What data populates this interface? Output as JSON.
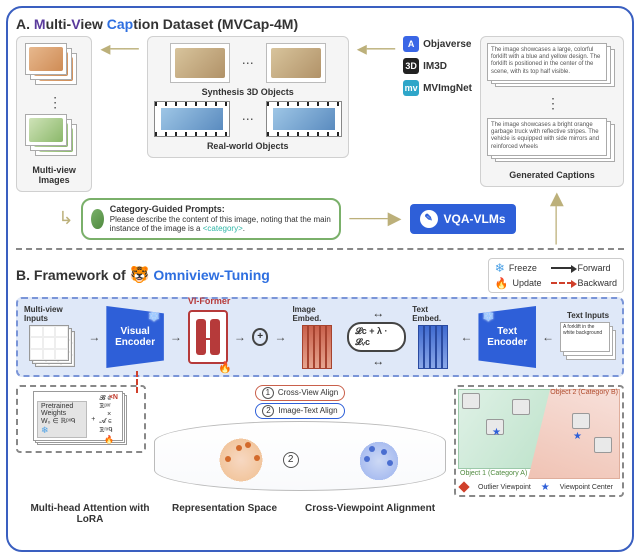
{
  "panelA": {
    "heading_prefix": "A. ",
    "heading_M": "M",
    "heading_ulti": "ulti-",
    "heading_V": "V",
    "heading_iew": "iew ",
    "heading_Cap": "Cap",
    "heading_tion": "tion Dataset (MVCap-4M)",
    "left_box_label": "Multi-view Images",
    "objects": {
      "synthesis": "Synthesis 3D Objects",
      "real": "Real-world Objects"
    },
    "datasets": [
      {
        "icon": "A",
        "name": "Objaverse"
      },
      {
        "icon": "3D",
        "name": "IM3D"
      },
      {
        "icon": "mv",
        "name": "MVImgNet"
      }
    ],
    "captions_label": "Generated Captions",
    "caption1": "The image showcases a large, colorful forklift with a blue and yellow design. The forklift is positioned in the center of the scene, with its top half visible.",
    "caption1_kw": "forklift",
    "caption2": "The image showcases a bright orange garbage truck with reflective stripes. The vehicle is equipped with side mirrors and reinforced wheels",
    "caption2_kw": "garbage truck",
    "prompt_title": "Category-Guided Prompts:",
    "prompt_body_a": "Please describe the content of this image, noting that the main instance of the image is a ",
    "prompt_body_cat": "<category>",
    "prompt_body_b": ".",
    "vqa_label": "VQA-VLMs"
  },
  "panelB": {
    "heading_prefix": "B. Framework of ",
    "heading_brand": "Omniview-Tuning",
    "legend": {
      "freeze": "Freeze",
      "update": "Update",
      "forward": "Forward",
      "backward": "Backward"
    },
    "blue_row": {
      "mv_inputs": "Multi-view Inputs",
      "visual_encoder": "Visual Encoder",
      "vi_former": "VI-Former",
      "image_embed": "Image Embed.",
      "text_embed": "Text Embed.",
      "loss": "𝓛ᴄ + λ · 𝓛ᵥᴄ",
      "text_encoder": "Text Encoder",
      "text_inputs": "Text Inputs",
      "sample_text": "A forklift in the white background"
    },
    "align": {
      "cross_view": "Cross-View Align",
      "image_text": "Image-Text Align"
    },
    "lora": {
      "times_n": "×N",
      "pretrained": "Pretrained Weights",
      "w0": "W₀ ∈ ℝᵖˣᑫ",
      "B": "𝓑 ∈ ℝᵖˣʳ",
      "A": "𝓐 ∈ ℝʳˣᑫ",
      "mult": "×",
      "label": "Multi-head Attention with LoRA",
      "lora_word": "LoRA"
    },
    "rep_label": "Representation Space",
    "cv": {
      "obj1": "Object 1 (Category A)",
      "obj2": "Object 2 (Category B)",
      "outlier": "Outlier Viewpoint",
      "center": "Viewpoint Center",
      "label": "Cross-Viewpoint Alignment"
    }
  }
}
